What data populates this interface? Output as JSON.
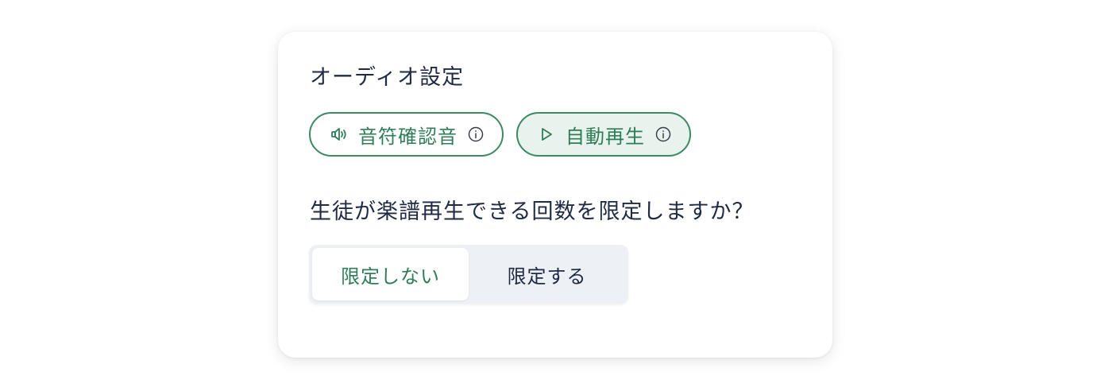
{
  "audio_settings": {
    "title": "オーディオ設定",
    "chips": [
      {
        "label": "音符確認音",
        "icon": "speaker-icon",
        "active": false
      },
      {
        "label": "自動再生",
        "icon": "play-icon",
        "active": true
      }
    ]
  },
  "playback_limit": {
    "question": "生徒が楽譜再生できる回数を限定しますか？",
    "options": [
      "限定しない",
      "限定する"
    ],
    "selected": "限定しない"
  },
  "colors": {
    "accent": "#2e7d57",
    "text": "#1f2a44",
    "segment_bg": "#edf0f5",
    "chip_active_bg": "#e8f3ed"
  }
}
